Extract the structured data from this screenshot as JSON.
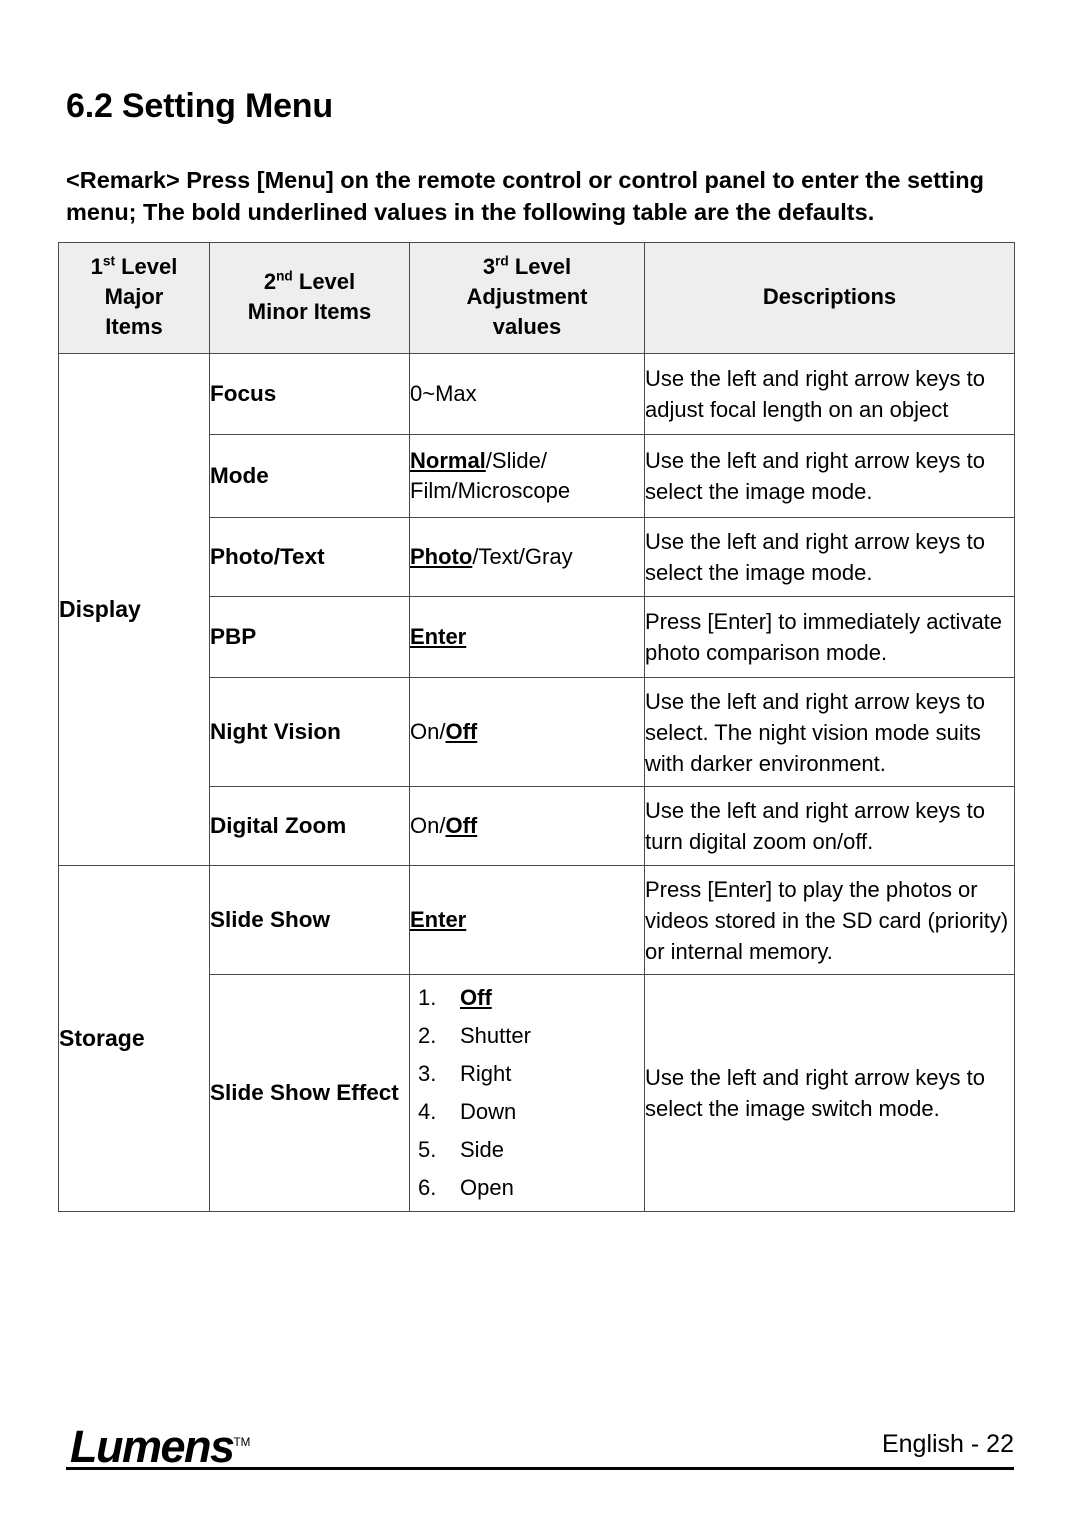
{
  "document": {
    "section_title": "6.2 Setting Menu",
    "remark": "<Remark> Press [Menu] on the remote control or control panel to enter the setting menu; The bold underlined values in the following table are the defaults."
  },
  "table": {
    "headers": {
      "col1_ordinal": "1",
      "col1_sup": "st",
      "col1_line1": " Level",
      "col1_line2": "Major",
      "col1_line3": "Items",
      "col2_ordinal": "2",
      "col2_sup": "nd",
      "col2_line1": " Level",
      "col2_line2": "Minor Items",
      "col3_ordinal": "3",
      "col3_sup": "rd",
      "col3_line1": " Level",
      "col3_line2": "Adjustment",
      "col3_line3": "values",
      "col4": "Descriptions"
    },
    "groups": [
      {
        "major": "Display",
        "rows": [
          {
            "minor": "Focus",
            "value_plain": "0~Max",
            "value_default": "",
            "value_tail": "",
            "description": "Use the left and right arrow keys to adjust focal length on an object"
          },
          {
            "minor": "Mode",
            "value_default": "Normal",
            "value_tail": "/Slide/ Film/Microscope",
            "description": "Use the left and right arrow keys to select the image mode."
          },
          {
            "minor": "Photo/Text",
            "value_default": "Photo",
            "value_tail": "/Text/Gray",
            "description": "Use the left and right arrow keys to select the image mode."
          },
          {
            "minor": "PBP",
            "value_default": "Enter",
            "value_tail": "",
            "description": "Press [Enter] to immediately activate photo comparison mode."
          },
          {
            "minor": "Night Vision",
            "value_lead": "On/",
            "value_default": "Off",
            "value_tail": "",
            "description": "Use the left and right arrow keys to select. The night vision mode suits with darker environment."
          },
          {
            "minor": "Digital Zoom",
            "value_lead": "On/",
            "value_default": "Off",
            "value_tail": "",
            "description": "Use the left and right arrow keys to turn digital zoom on/off."
          }
        ]
      },
      {
        "major": "Storage",
        "rows": [
          {
            "minor": "Slide Show",
            "value_default": "Enter",
            "value_tail": "",
            "description": "Press [Enter] to play the photos or videos stored in the SD card (priority) or internal memory."
          },
          {
            "minor": "Slide Show Effect",
            "options": [
              {
                "label": "Off",
                "is_default": true
              },
              {
                "label": "Shutter",
                "is_default": false
              },
              {
                "label": "Right",
                "is_default": false
              },
              {
                "label": "Down",
                "is_default": false
              },
              {
                "label": "Side",
                "is_default": false
              },
              {
                "label": "Open",
                "is_default": false
              }
            ],
            "description": "Use the left and right arrow keys to select the image switch mode."
          }
        ]
      }
    ]
  },
  "footer": {
    "logo_text": "Lumens",
    "logo_tm": "TM",
    "page_label": "English  -  22"
  }
}
